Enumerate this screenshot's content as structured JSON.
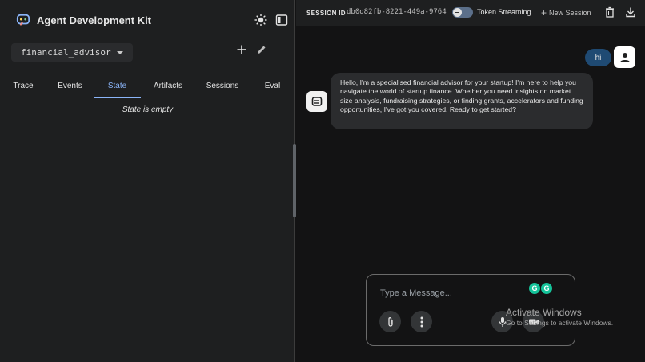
{
  "app": {
    "title": "Agent Development Kit"
  },
  "agent_selector": {
    "value": "financial_advisor"
  },
  "tabs": [
    {
      "label": "Trace",
      "active": false
    },
    {
      "label": "Events",
      "active": false
    },
    {
      "label": "State",
      "active": true
    },
    {
      "label": "Artifacts",
      "active": false
    },
    {
      "label": "Sessions",
      "active": false
    },
    {
      "label": "Eval",
      "active": false
    }
  ],
  "state_panel": {
    "empty_text": "State is empty"
  },
  "session_bar": {
    "session_label": "SESSION ID",
    "session_id": "db0d82fb-8221-449a-9764",
    "token_streaming_label": "Token Streaming",
    "token_streaming_on": false,
    "new_session_label": "New Session"
  },
  "chat": {
    "messages": [
      {
        "role": "user",
        "text": "hi"
      },
      {
        "role": "bot",
        "text": "Hello, I'm a specialised financial advisor for your startup! I'm here to help you navigate the world of startup finance. Whether you need insights on market size analysis, fundraising strategies, or finding grants, accelerators and funding opportunities, I've got you covered. Ready to get started?"
      }
    ]
  },
  "composer": {
    "placeholder": "Type a Message..."
  },
  "watermark": {
    "title": "Activate Windows",
    "subtitle": "Go to Settings to activate Windows."
  },
  "colors": {
    "accent": "#8ab4f8",
    "user_bubble": "#1f4a73",
    "panel": "#1e1f20",
    "background": "#131314"
  },
  "icons": {
    "logo": "adk-logo-icon",
    "theme": "sun-icon",
    "sidebar": "side-panel-icon",
    "add": "plus-icon",
    "edit": "pencil-icon",
    "delete": "trash-icon",
    "download": "download-icon",
    "attach": "paperclip-icon",
    "more": "more-vert-icon",
    "mic": "mic-icon",
    "video": "videocam-icon"
  }
}
